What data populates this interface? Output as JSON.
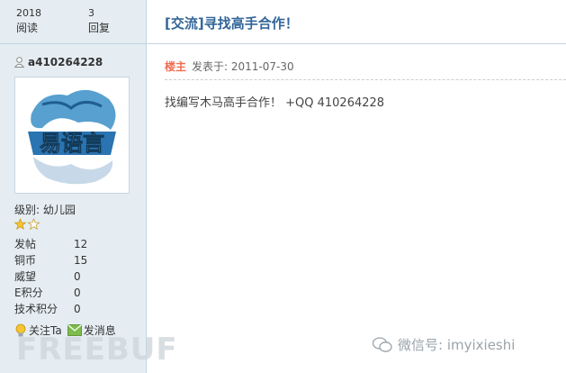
{
  "stats": {
    "views_num": "2018",
    "views_label": "阅读",
    "replies_num": "3",
    "replies_label": "回复"
  },
  "user": {
    "name": "a410264228",
    "avatar_text": "易语言",
    "level": "级别: 幼儿园",
    "info": [
      {
        "k": "发帖",
        "v": "12"
      },
      {
        "k": "铜币",
        "v": "15"
      },
      {
        "k": "威望",
        "v": "0"
      },
      {
        "k": "E积分",
        "v": "0"
      },
      {
        "k": "技术积分",
        "v": "0"
      }
    ],
    "follow_label": "关注Ta",
    "message_label": "发消息",
    "stars": 1.5
  },
  "post": {
    "title": "[交流]寻找高手合作！",
    "op_badge": "楼主",
    "posted": "发表于: 2011-07-30",
    "content": "找编写木马高手合作！ +QQ 410264228"
  },
  "watermark": {
    "left": "FREEBUF",
    "right": "微信号: imyixieshi"
  },
  "colors": {
    "sidebar_bg": "#e5edf2",
    "title": "#336699",
    "op": "#f26c4f"
  }
}
